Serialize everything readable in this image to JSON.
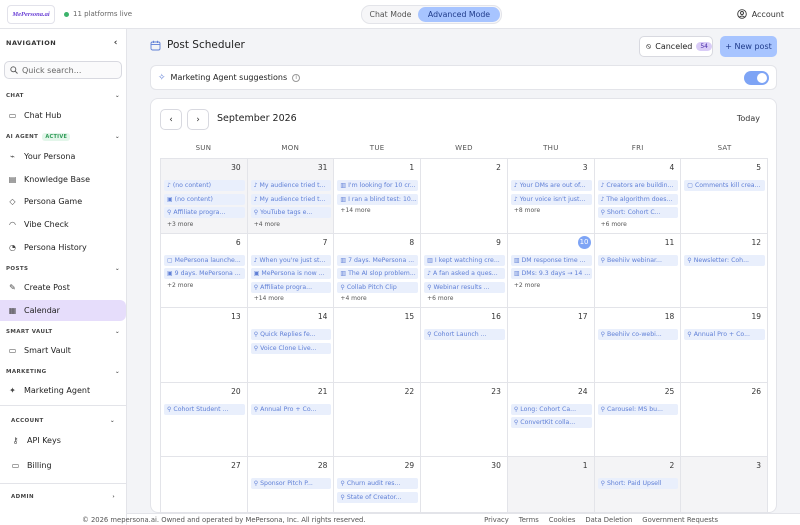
{
  "topbar": {
    "logo": "MePersona.ai",
    "live_status": "11 platforms live",
    "modes": [
      "Chat Mode",
      "Advanced Mode"
    ],
    "account": "Account"
  },
  "sidebar": {
    "heading": "NAVIGATION",
    "search_placeholder": "Quick search...",
    "sections": {
      "chat": "CHAT",
      "ai_agent": "AI AGENT",
      "ai_agent_badge": "ACTIVE",
      "posts": "POSTS",
      "smart_vault": "SMART VAULT",
      "marketing": "MARKETING",
      "account": "ACCOUNT",
      "admin": "ADMIN"
    },
    "items": {
      "chat_hub": "Chat Hub",
      "your_persona": "Your Persona",
      "knowledge_base": "Knowledge Base",
      "persona_game": "Persona Game",
      "vibe_check": "Vibe Check",
      "persona_history": "Persona History",
      "create_post": "Create Post",
      "calendar": "Calendar",
      "smart_vault": "Smart Vault",
      "marketing_agent": "Marketing Agent",
      "api_keys": "API Keys",
      "billing": "Billing"
    }
  },
  "header": {
    "title": "Post Scheduler",
    "canceled_label": "Canceled",
    "canceled_count": "54",
    "new_post": "+ New post"
  },
  "agent_bar": {
    "label": "Marketing Agent suggestions",
    "enabled": true
  },
  "calendar": {
    "month": "September 2026",
    "today_label": "Today",
    "weekdays": [
      "SUN",
      "MON",
      "TUE",
      "WED",
      "THU",
      "FRI",
      "SAT"
    ],
    "weeks": [
      [
        {
          "d": "30",
          "dim": true,
          "events": [
            {
              "i": "music",
              "t": "(no content)"
            },
            {
              "i": "image",
              "t": "(no content)"
            },
            {
              "i": "link",
              "t": "Affiliate progra..."
            }
          ],
          "more": "+3 more"
        },
        {
          "d": "31",
          "dim": true,
          "events": [
            {
              "i": "music",
              "t": "My audience tried t..."
            },
            {
              "i": "music",
              "t": "My audience tried t..."
            },
            {
              "i": "link",
              "t": "YouTube tags e..."
            }
          ],
          "more": "+4 more"
        },
        {
          "d": "1",
          "events": [
            {
              "i": "bars",
              "t": "I'm looking for 10 cr..."
            },
            {
              "i": "bars",
              "t": "I ran a blind test: 10..."
            }
          ],
          "more": "+14 more"
        },
        {
          "d": "2",
          "events": []
        },
        {
          "d": "3",
          "events": [
            {
              "i": "music",
              "t": "Your DMs are out of..."
            },
            {
              "i": "music",
              "t": "Your voice isn't just..."
            }
          ],
          "more": "+8 more"
        },
        {
          "d": "4",
          "events": [
            {
              "i": "music",
              "t": "Creators are buildin..."
            },
            {
              "i": "music",
              "t": "The algorithm does..."
            },
            {
              "i": "link",
              "t": "Short: Cohort C..."
            }
          ],
          "more": "+6 more"
        },
        {
          "d": "5",
          "events": [
            {
              "i": "chat",
              "t": "Comments kill crea..."
            }
          ]
        }
      ],
      [
        {
          "d": "6",
          "events": [
            {
              "i": "chat",
              "t": "MePersona launche..."
            },
            {
              "i": "image",
              "t": "9 days. MePersona ..."
            }
          ],
          "more": "+2 more"
        },
        {
          "d": "7",
          "events": [
            {
              "i": "music",
              "t": "When you're just st..."
            },
            {
              "i": "image",
              "t": "MePersona is now ..."
            },
            {
              "i": "link",
              "t": "Affiliate progra..."
            }
          ],
          "more": "+14 more"
        },
        {
          "d": "8",
          "events": [
            {
              "i": "bars",
              "t": "7 days. MePersona ..."
            },
            {
              "i": "bars",
              "t": "The AI slop problem..."
            },
            {
              "i": "link",
              "t": "Collab Pitch Clip"
            }
          ],
          "more": "+4 more"
        },
        {
          "d": "9",
          "events": [
            {
              "i": "bars",
              "t": "I kept watching cre..."
            },
            {
              "i": "music",
              "t": "A fan asked a ques..."
            },
            {
              "i": "link",
              "t": "Webinar results ..."
            }
          ],
          "more": "+6 more"
        },
        {
          "d": "10",
          "today": true,
          "events": [
            {
              "i": "bars",
              "t": "DM response time ..."
            },
            {
              "i": "bars",
              "t": "DMs: 9.3 days → 14 ..."
            }
          ],
          "more": "+2 more"
        },
        {
          "d": "11",
          "events": [
            {
              "i": "link",
              "t": "Beehiiv webinar..."
            }
          ]
        },
        {
          "d": "12",
          "events": [
            {
              "i": "link",
              "t": "Newsletter: Coh..."
            }
          ]
        }
      ],
      [
        {
          "d": "13",
          "events": []
        },
        {
          "d": "14",
          "events": [
            {
              "i": "link",
              "t": "Quick Replies fe..."
            },
            {
              "i": "link",
              "t": "Voice Clone Live..."
            }
          ]
        },
        {
          "d": "15",
          "events": []
        },
        {
          "d": "16",
          "events": [
            {
              "i": "link",
              "t": "Cohort Launch ..."
            }
          ]
        },
        {
          "d": "17",
          "events": []
        },
        {
          "d": "18",
          "events": [
            {
              "i": "link",
              "t": "Beehiiv co-webi..."
            }
          ]
        },
        {
          "d": "19",
          "events": [
            {
              "i": "link",
              "t": "Annual Pro + Co..."
            }
          ]
        }
      ],
      [
        {
          "d": "20",
          "events": [
            {
              "i": "link",
              "t": "Cohort Student ..."
            }
          ]
        },
        {
          "d": "21",
          "events": [
            {
              "i": "link",
              "t": "Annual Pro + Co..."
            }
          ]
        },
        {
          "d": "22",
          "events": []
        },
        {
          "d": "23",
          "events": []
        },
        {
          "d": "24",
          "events": [
            {
              "i": "link",
              "t": "Long: Cohort Ca..."
            },
            {
              "i": "link",
              "t": "ConvertKit colla..."
            }
          ]
        },
        {
          "d": "25",
          "events": [
            {
              "i": "link",
              "t": "Carousel: MS bu..."
            }
          ]
        },
        {
          "d": "26",
          "events": []
        }
      ],
      [
        {
          "d": "27",
          "events": []
        },
        {
          "d": "28",
          "events": [
            {
              "i": "link",
              "t": "Sponsor Pitch P..."
            }
          ]
        },
        {
          "d": "29",
          "events": [
            {
              "i": "link",
              "t": "Churn audit res..."
            },
            {
              "i": "link",
              "t": "State of Creator..."
            }
          ]
        },
        {
          "d": "30",
          "events": []
        },
        {
          "d": "1",
          "dim": true,
          "events": []
        },
        {
          "d": "2",
          "dim": true,
          "events": [
            {
              "i": "link",
              "t": "Short: Paid Upsell"
            }
          ]
        },
        {
          "d": "3",
          "dim": true,
          "events": []
        }
      ]
    ]
  },
  "footer": {
    "copyright": "© 2026 mepersona.ai. Owned and operated by MePersona, Inc. All rights reserved.",
    "links": [
      "Privacy",
      "Terms",
      "Cookies",
      "Data Deletion",
      "Government Requests"
    ]
  },
  "colors": {
    "accent": "#a7c4ff",
    "event_bg": "#e9effc",
    "event_text": "#5f7fd6",
    "active_nav": "#e6ddfb"
  }
}
